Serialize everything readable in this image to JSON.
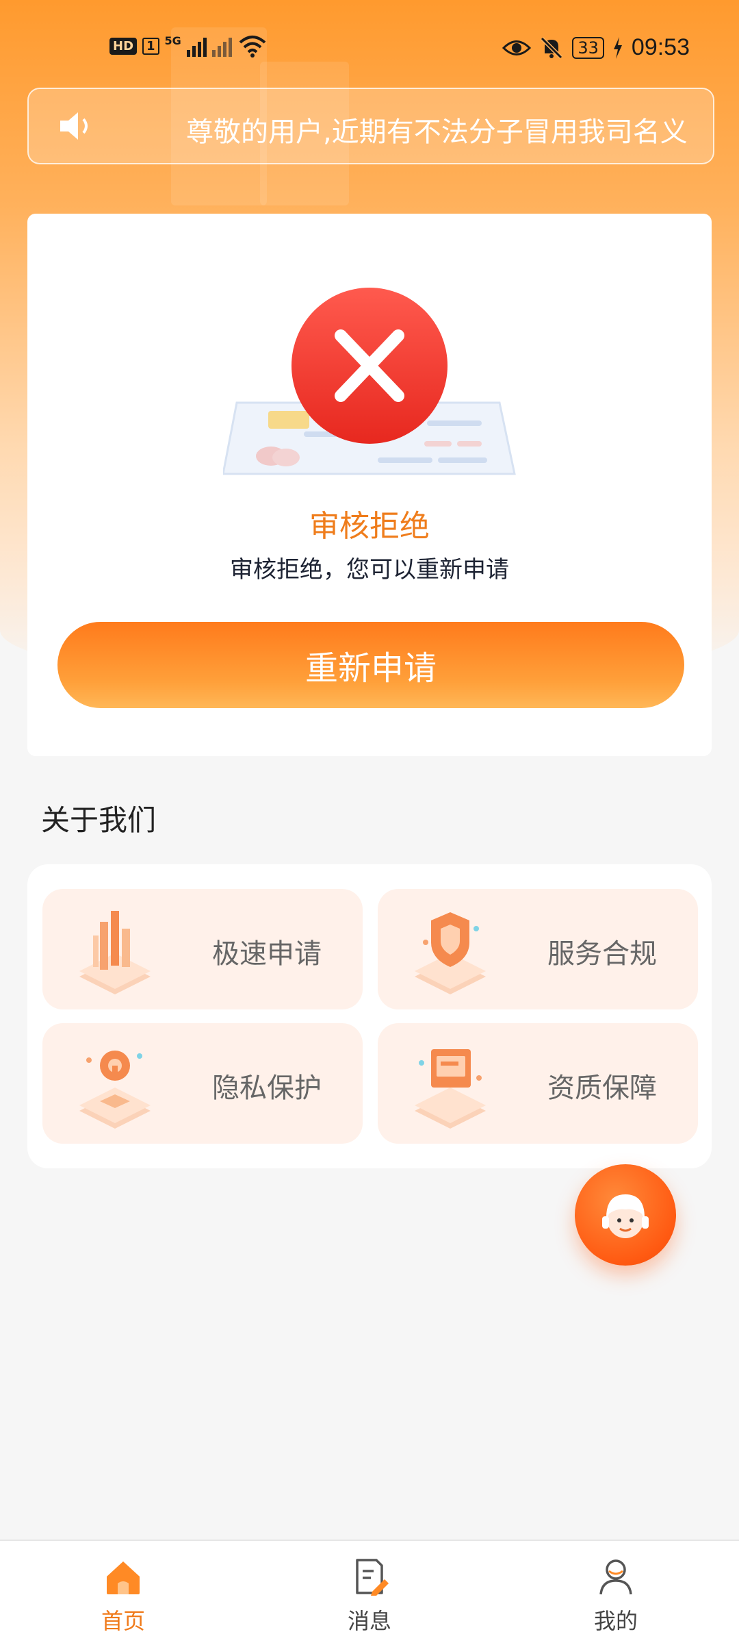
{
  "status_bar": {
    "hd": "HD",
    "sim": "1",
    "network": "5G",
    "battery": "33",
    "time": "09:53"
  },
  "notice": {
    "icon": "speaker-icon",
    "text": "尊敬的用户,近期有不法分子冒用我司名义"
  },
  "review": {
    "icon": "rejected-x-icon",
    "title": "审核拒绝",
    "subtitle": "审核拒绝，您可以重新申请",
    "button_label": "重新申请"
  },
  "about": {
    "title": "关于我们",
    "items": [
      {
        "label": "极速申请",
        "icon": "fast-apply-icon"
      },
      {
        "label": "服务合规",
        "icon": "compliance-shield-icon"
      },
      {
        "label": "隐私保护",
        "icon": "privacy-lock-icon"
      },
      {
        "label": "资质保障",
        "icon": "qualification-certificate-icon"
      }
    ]
  },
  "fab": {
    "icon": "customer-service-icon"
  },
  "tabs": [
    {
      "label": "首页",
      "icon": "home-icon",
      "active": true
    },
    {
      "label": "消息",
      "icon": "message-icon",
      "active": false
    },
    {
      "label": "我的",
      "icon": "profile-icon",
      "active": false
    }
  ],
  "colors": {
    "brand_orange": "#ff8a25",
    "accent_text": "#ef7d1c",
    "reject_red": "#ee3b34",
    "tile_bg": "#fff1ea"
  }
}
